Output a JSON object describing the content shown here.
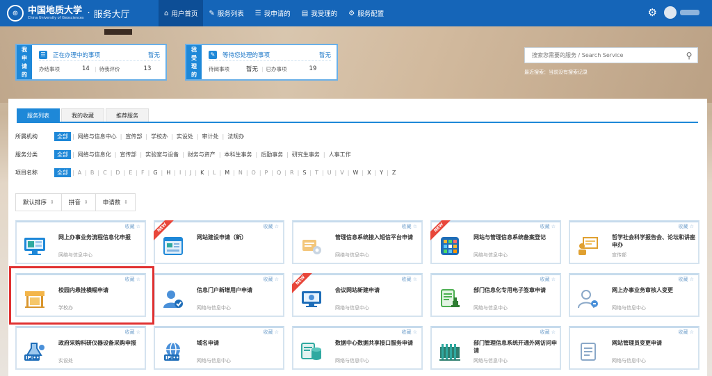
{
  "header": {
    "logo_cn": "中国地质大学",
    "logo_en": "China University of Geosciences",
    "separator": "·",
    "portal_title": "服务大厅",
    "nav": [
      {
        "label": "用户首页",
        "icon": "home-icon",
        "glyph": "⌂"
      },
      {
        "label": "服务列表",
        "icon": "edit-icon",
        "glyph": "✎"
      },
      {
        "label": "我申请的",
        "icon": "list-icon",
        "glyph": "☰"
      },
      {
        "label": "我受理的",
        "icon": "folder-icon",
        "glyph": "▤"
      },
      {
        "label": "服务配置",
        "icon": "gears-icon",
        "glyph": "⚙"
      }
    ]
  },
  "summary": {
    "left": {
      "side": [
        "我",
        "申",
        "请",
        "的"
      ],
      "title": "正在办理中的事项",
      "none": "暂无",
      "r1_label": "办结事项",
      "r1_value": "14",
      "r2_label": "待我评价",
      "r2_value": "13"
    },
    "right": {
      "side": [
        "我",
        "受",
        "理",
        "的"
      ],
      "title": "等待您处理的事项",
      "none": "暂无",
      "r1_label": "待阅事项",
      "r1_value": "暂无",
      "r2_label": "已办事项",
      "r2_value": "19"
    }
  },
  "search": {
    "placeholder": "搜索您需要的服务 / Search Service",
    "recent": "最近搜索：当前没有搜索记录"
  },
  "tabs": [
    "服务列表",
    "我的收藏",
    "推荐服务"
  ],
  "filters": {
    "org": {
      "label": "所属机构",
      "items": [
        "全部",
        "网络与信息中心",
        "宣传部",
        "学校办",
        "实设处",
        "审计处",
        "法规办"
      ]
    },
    "category": {
      "label": "服务分类",
      "items": [
        "全部",
        "网络与信息化",
        "宣传部",
        "实验室与设备",
        "财务与资产",
        "本科生事务",
        "后勤事务",
        "研究生事务",
        "人事工作"
      ]
    },
    "name": {
      "label": "项目名称",
      "items": [
        "全部",
        "A",
        "B",
        "C",
        "D",
        "E",
        "F",
        "G",
        "H",
        "I",
        "J",
        "K",
        "L",
        "M",
        "N",
        "O",
        "P",
        "Q",
        "R",
        "S",
        "T",
        "U",
        "V",
        "W",
        "X",
        "Y",
        "Z"
      ]
    }
  },
  "sort": [
    "默认排序",
    "拼音",
    "申请数"
  ],
  "fav_label": "收藏",
  "new_label": "NEW",
  "cards": [
    {
      "title": "网上办事业务流程信息化申报",
      "dept": "网络与信息中心",
      "icon": "monitor-icon",
      "new": false
    },
    {
      "title": "网站建设申请（新）",
      "dept": "",
      "icon": "website-icon",
      "new": true
    },
    {
      "title": "管理信息系统接入短信平台申请",
      "dept": "网络与信息中心",
      "icon": "sms-gear-icon",
      "new": false
    },
    {
      "title": "网站与管理信息系统备案登记",
      "dept": "网络与信息中心",
      "icon": "apps-grid-icon",
      "new": true
    },
    {
      "title": "哲学社会科学报告会、论坛和讲座申办",
      "dept": "宣传部",
      "icon": "lecture-icon",
      "new": false
    },
    {
      "title": "校园内悬挂横幅申请",
      "dept": "学校办",
      "icon": "banner-icon",
      "new": false
    },
    {
      "title": "信息门户新增用户申请",
      "dept": "网络与信息中心",
      "icon": "user-check-icon",
      "new": false
    },
    {
      "title": "会议网站新建申请",
      "dept": "网络与信息中心",
      "icon": "conference-web-icon",
      "new": true
    },
    {
      "title": "部门信息化专用电子签章申请",
      "dept": "网络与信息中心",
      "icon": "seal-doc-icon",
      "new": false
    },
    {
      "title": "网上办事业务审核人变更",
      "dept": "网络与信息中心",
      "icon": "user-swap-icon",
      "new": false
    },
    {
      "title": "政府采购科研仪器设备采购申报",
      "dept": "实设处",
      "icon": "lab-ip-icon",
      "new": false
    },
    {
      "title": "域名申请",
      "dept": "网络与信息中心",
      "icon": "globe-ip-icon",
      "new": false
    },
    {
      "title": "数据中心数据共享接口服务申请",
      "dept": "网络与信息中心",
      "icon": "database-icon",
      "new": false
    },
    {
      "title": "部门管理信息系统开通外网访问申请",
      "dept": "网络与信息中心",
      "icon": "firewall-icon",
      "new": false
    },
    {
      "title": "网站管理员变更申请",
      "dept": "网络与信息中心",
      "icon": "doc-edit-icon",
      "new": false
    }
  ]
}
